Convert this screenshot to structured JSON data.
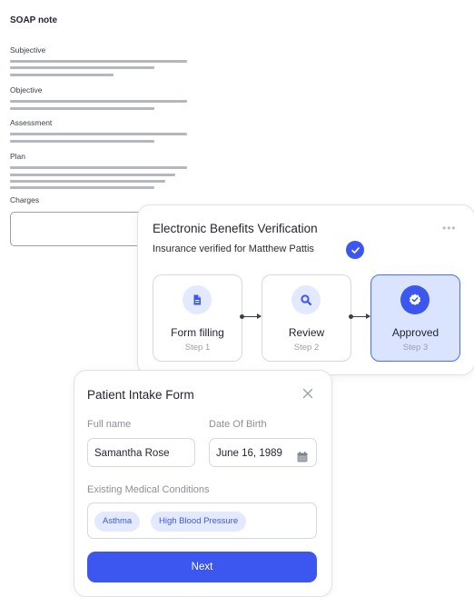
{
  "soap": {
    "title": "SOAP note",
    "sections": [
      "Subjective",
      "Objective",
      "Assessment",
      "Plan",
      "Charges"
    ]
  },
  "ebv": {
    "title": "Electronic Benefits Verification",
    "subtitle": "Insurance verified for Matthew Pattis",
    "more_label": "•••",
    "steps": [
      {
        "label": "Form filling",
        "sub": "Step 1",
        "icon": "document-icon"
      },
      {
        "label": "Review",
        "sub": "Step 2",
        "icon": "search-icon"
      },
      {
        "label": "Approved",
        "sub": "Step 3",
        "icon": "check-badge-icon"
      }
    ],
    "active_step": 3
  },
  "intake": {
    "title": "Patient Intake Form",
    "full_name_label": "Full name",
    "full_name_value": "Samantha Rose",
    "dob_label": "Date Of Birth",
    "dob_value": "June 16, 1989",
    "conditions_label": "Existing Medical Conditions",
    "conditions": [
      "Asthma",
      "High Blood Pressure"
    ],
    "next_label": "Next"
  },
  "colors": {
    "accent": "#3c57f0",
    "accent_light": "#e3e9ff",
    "active_step_bg": "#dbe4ff"
  }
}
